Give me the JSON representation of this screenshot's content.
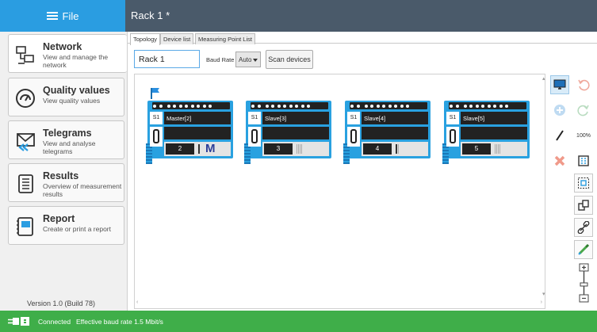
{
  "header": {
    "file_label": "File",
    "document_title": "Rack 1 *"
  },
  "sidebar": {
    "items": [
      {
        "title": "Network",
        "subtitle": "View and manage the network",
        "icon": "network-icon",
        "active": true
      },
      {
        "title": "Quality values",
        "subtitle": "View quality values",
        "icon": "gauge-icon"
      },
      {
        "title": "Telegrams",
        "subtitle": "View and analyse telegrams",
        "icon": "envelope-icon"
      },
      {
        "title": "Results",
        "subtitle": "Overview of measurement results",
        "icon": "list-document-icon"
      },
      {
        "title": "Report",
        "subtitle": "Create or print a report",
        "icon": "report-book-icon"
      }
    ],
    "version": "Version 1.0 (Build 78)"
  },
  "main": {
    "tabs": [
      {
        "label": "Topology",
        "active": true
      },
      {
        "label": "Device list"
      },
      {
        "label": "Measuring Point List"
      }
    ],
    "rack_name_value": "Rack 1",
    "baud_rate_label": "Baud Rate",
    "baud_rate_value": "Auto",
    "scan_button": "Scan devices",
    "devices": [
      {
        "slot": "S1",
        "name": "Master[2]",
        "address": "2",
        "master": true
      },
      {
        "slot": "S1",
        "name": "Slave[3]",
        "address": "3"
      },
      {
        "slot": "S1",
        "name": "Slave[4]",
        "address": "4"
      },
      {
        "slot": "S1",
        "name": "Slave[5]",
        "address": "5"
      }
    ],
    "master_logo": "M"
  },
  "toolbar": {
    "zoom_label": "100%",
    "tools": [
      "monitor-icon",
      "undo-icon",
      "add-icon",
      "redo-icon",
      "line-icon",
      "zoom-100-icon",
      "delete-icon",
      "fit-icon",
      "select-area-icon",
      "arrange-icon",
      "link-icon",
      "color-picker-icon",
      "zoom-slider"
    ]
  },
  "statusbar": {
    "connection": "Connected",
    "baud_info": "Effective baud rate 1.5 Mbit/s"
  },
  "colors": {
    "accent": "#2a9de1",
    "titlebar": "#4a5a6a",
    "device_blue": "#29a1e0",
    "status_green": "#3fae49",
    "logo_navy": "#2c3e98"
  }
}
